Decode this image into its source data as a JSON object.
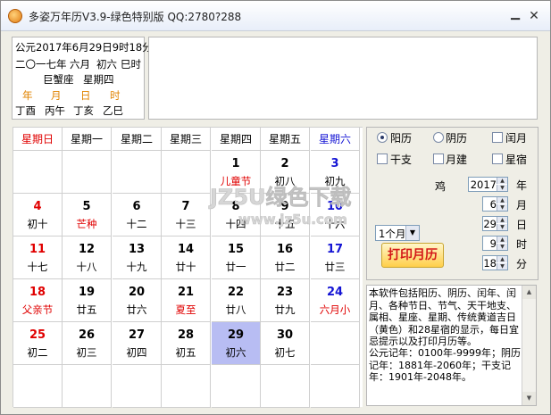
{
  "title": "多姿万年历V3.9-绿色特别版 QQ:2780?288",
  "info": {
    "line1": "公元2017年6月29日9时18分",
    "line2": [
      "二〇一七年",
      "六月",
      "初六",
      "巳时"
    ],
    "line3": [
      "巨蟹座",
      "星期四"
    ],
    "labels": [
      "年",
      "月",
      "日",
      "时"
    ],
    "ganzhi": [
      "丁酉",
      "丙午",
      "丁亥",
      "乙巳"
    ]
  },
  "weekdays": [
    "星期日",
    "星期一",
    "星期二",
    "星期三",
    "星期四",
    "星期五",
    "星期六"
  ],
  "days": [
    {
      "n": "1",
      "s": "儿童节",
      "nc": "",
      "sc": "red",
      "col": 4,
      "row": 0
    },
    {
      "n": "2",
      "s": "初八",
      "nc": "",
      "sc": "",
      "col": 5,
      "row": 0
    },
    {
      "n": "3",
      "s": "初九",
      "nc": "blue",
      "sc": "",
      "col": 6,
      "row": 0
    },
    {
      "n": "4",
      "s": "初十",
      "nc": "red",
      "sc": "",
      "col": 0,
      "row": 1
    },
    {
      "n": "5",
      "s": "芒种",
      "nc": "",
      "sc": "red",
      "col": 1,
      "row": 1
    },
    {
      "n": "6",
      "s": "十二",
      "nc": "",
      "sc": "",
      "col": 2,
      "row": 1
    },
    {
      "n": "7",
      "s": "十三",
      "nc": "",
      "sc": "",
      "col": 3,
      "row": 1
    },
    {
      "n": "8",
      "s": "十四",
      "nc": "",
      "sc": "",
      "col": 4,
      "row": 1
    },
    {
      "n": "9",
      "s": "十五",
      "nc": "",
      "sc": "",
      "col": 5,
      "row": 1
    },
    {
      "n": "10",
      "s": "十六",
      "nc": "blue",
      "sc": "",
      "col": 6,
      "row": 1
    },
    {
      "n": "11",
      "s": "十七",
      "nc": "red",
      "sc": "",
      "col": 0,
      "row": 2
    },
    {
      "n": "12",
      "s": "十八",
      "nc": "",
      "sc": "",
      "col": 1,
      "row": 2
    },
    {
      "n": "13",
      "s": "十九",
      "nc": "",
      "sc": "",
      "col": 2,
      "row": 2
    },
    {
      "n": "14",
      "s": "廿十",
      "nc": "",
      "sc": "",
      "col": 3,
      "row": 2
    },
    {
      "n": "15",
      "s": "廿一",
      "nc": "",
      "sc": "",
      "col": 4,
      "row": 2
    },
    {
      "n": "16",
      "s": "廿二",
      "nc": "",
      "sc": "",
      "col": 5,
      "row": 2
    },
    {
      "n": "17",
      "s": "廿三",
      "nc": "blue",
      "sc": "",
      "col": 6,
      "row": 2
    },
    {
      "n": "18",
      "s": "父亲节",
      "nc": "red",
      "sc": "red",
      "col": 0,
      "row": 3
    },
    {
      "n": "19",
      "s": "廿五",
      "nc": "",
      "sc": "",
      "col": 1,
      "row": 3
    },
    {
      "n": "20",
      "s": "廿六",
      "nc": "",
      "sc": "",
      "col": 2,
      "row": 3
    },
    {
      "n": "21",
      "s": "夏至",
      "nc": "",
      "sc": "red",
      "col": 3,
      "row": 3
    },
    {
      "n": "22",
      "s": "廿八",
      "nc": "",
      "sc": "",
      "col": 4,
      "row": 3
    },
    {
      "n": "23",
      "s": "廿九",
      "nc": "",
      "sc": "",
      "col": 5,
      "row": 3
    },
    {
      "n": "24",
      "s": "六月小",
      "nc": "blue",
      "sc": "red",
      "col": 6,
      "row": 3
    },
    {
      "n": "25",
      "s": "初二",
      "nc": "red",
      "sc": "",
      "col": 0,
      "row": 4
    },
    {
      "n": "26",
      "s": "初三",
      "nc": "",
      "sc": "",
      "col": 1,
      "row": 4
    },
    {
      "n": "27",
      "s": "初四",
      "nc": "",
      "sc": "",
      "col": 2,
      "row": 4
    },
    {
      "n": "28",
      "s": "初五",
      "nc": "",
      "sc": "",
      "col": 3,
      "row": 4
    },
    {
      "n": "29",
      "s": "初六",
      "nc": "",
      "sc": "",
      "col": 4,
      "row": 4,
      "selected": true
    },
    {
      "n": "30",
      "s": "初七",
      "nc": "",
      "sc": "",
      "col": 5,
      "row": 4
    }
  ],
  "controls": {
    "solar": "阳历",
    "lunar": "阴历",
    "leap": "闰月",
    "ganzhi": "干支",
    "month_build": "月建",
    "star": "星宿",
    "rooster": "鸡",
    "year_value": "2017",
    "year_unit": "年",
    "month_value": "6",
    "month_unit": "月",
    "day_value": "29",
    "day_unit": "日",
    "hour_value": "9",
    "hour_unit": "时",
    "minute_value": "18",
    "minute_unit": "分",
    "span_select": "1个月",
    "print": "打印月历"
  },
  "description": {
    "p1": "本软件包括阳历、阴历、闰年、闰月、各种节日、节气、天干地支、属相、星座、星期、传统黄道吉日（黄色）和28星宿的显示，每日宜忌提示以及打印月历等。",
    "p2": "公元记年：0100年-9999年；阴历记年：1881年-2060年；干支记年：1901年-2048年。"
  },
  "watermark": {
    "line1": "JZ5U绿色下载",
    "line2": "www.jz5u.com"
  }
}
